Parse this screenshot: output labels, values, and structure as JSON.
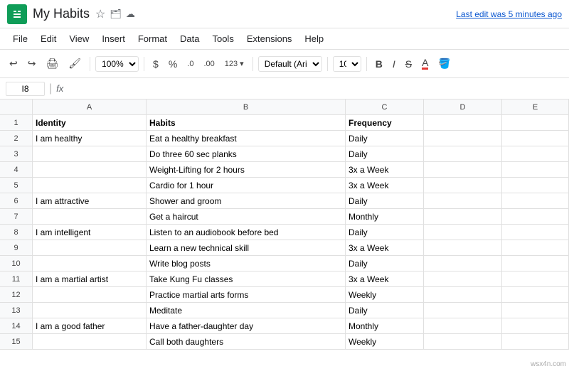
{
  "titleBar": {
    "title": "My Habits",
    "lastEdit": "Last edit was 5 minutes ago",
    "sheetsIconLabel": "S"
  },
  "menuBar": {
    "items": [
      "File",
      "Edit",
      "View",
      "Insert",
      "Format",
      "Data",
      "Tools",
      "Extensions",
      "Help"
    ]
  },
  "toolbar": {
    "zoom": "100%",
    "dollarSign": "$",
    "percentSign": "%",
    "decimal0": ".0",
    "decimal00": ".00",
    "format123": "123",
    "fontName": "Default (Ari...",
    "fontSize": "10",
    "boldLabel": "B",
    "italicLabel": "I",
    "strikeLabel": "S",
    "underlineALabel": "A",
    "paintLabel": "🪣"
  },
  "formulaBar": {
    "cellRef": "I8",
    "fx": "fx"
  },
  "columns": {
    "headers": [
      "A",
      "B",
      "C",
      "D",
      "E"
    ],
    "widths": [
      160,
      280,
      110,
      110,
      94
    ]
  },
  "rows": [
    {
      "num": 1,
      "a": "Identity",
      "a_bold": true,
      "b": "Habits",
      "b_bold": true,
      "c": "Frequency",
      "c_bold": true,
      "d": "",
      "e": ""
    },
    {
      "num": 2,
      "a": "I am healthy",
      "a_bold": false,
      "b": "Eat a healthy breakfast",
      "c": "Daily",
      "d": "",
      "e": ""
    },
    {
      "num": 3,
      "a": "",
      "b": "Do three 60 sec planks",
      "c": "Daily",
      "d": "",
      "e": ""
    },
    {
      "num": 4,
      "a": "",
      "b": "Weight-Lifting for 2 hours",
      "c": "3x a Week",
      "d": "",
      "e": ""
    },
    {
      "num": 5,
      "a": "",
      "b": "Cardio for 1 hour",
      "c": "3x a Week",
      "d": "",
      "e": ""
    },
    {
      "num": 6,
      "a": "I am attractive",
      "b": "Shower and groom",
      "c": "Daily",
      "d": "",
      "e": ""
    },
    {
      "num": 7,
      "a": "",
      "b": "Get a haircut",
      "c": "Monthly",
      "d": "",
      "e": ""
    },
    {
      "num": 8,
      "a": "I am intelligent",
      "b": "Listen to an audiobook before bed",
      "c": "Daily",
      "d": "",
      "e": ""
    },
    {
      "num": 9,
      "a": "",
      "b": "Learn a new technical skill",
      "c": "3x a Week",
      "d": "",
      "e": ""
    },
    {
      "num": 10,
      "a": "",
      "b": "Write blog posts",
      "c": "Daily",
      "d": "",
      "e": ""
    },
    {
      "num": 11,
      "a": "I am a martial artist",
      "b": "Take Kung Fu classes",
      "c": "3x a Week",
      "d": "",
      "e": ""
    },
    {
      "num": 12,
      "a": "",
      "b": "Practice martial arts forms",
      "c": "Weekly",
      "d": "",
      "e": ""
    },
    {
      "num": 13,
      "a": "",
      "b": "Meditate",
      "c": "Daily",
      "d": "",
      "e": ""
    },
    {
      "num": 14,
      "a": "I am a good father",
      "b": "Have a father-daughter day",
      "c": "Monthly",
      "d": "",
      "e": ""
    },
    {
      "num": 15,
      "a": "",
      "b": "Call both daughters",
      "c": "Weekly",
      "d": "",
      "e": ""
    }
  ],
  "watermark": "wsx4n.com"
}
